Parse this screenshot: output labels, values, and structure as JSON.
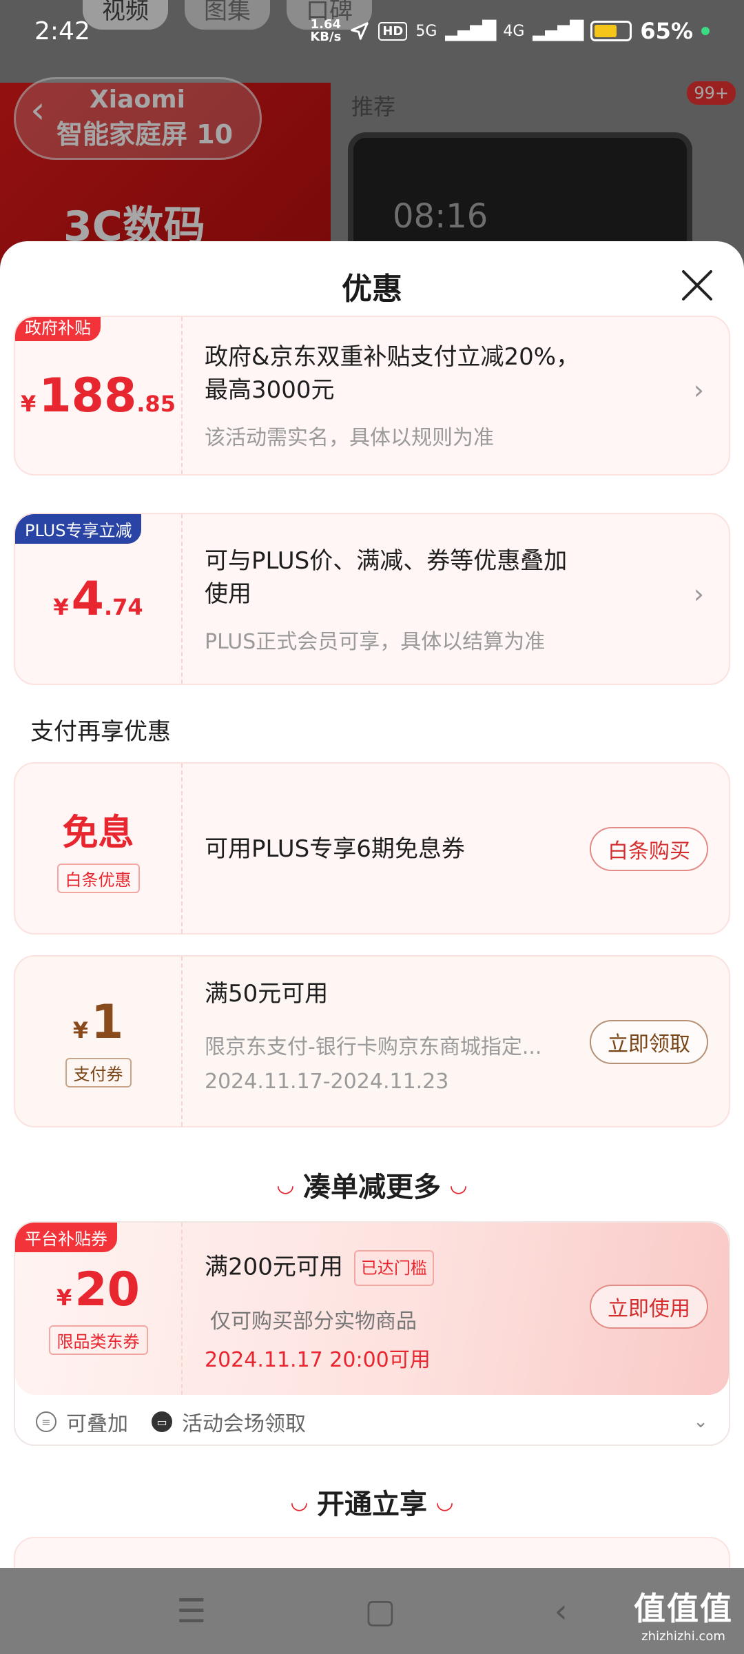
{
  "status_bar": {
    "time": "2:42",
    "speed_value": "1.64",
    "speed_unit": "KB/s",
    "hd": "HD",
    "net1": "5G",
    "net2": "4G",
    "battery": "65%",
    "battery_level": 0.65
  },
  "background": {
    "tabs": [
      "视频",
      "图集",
      "口碑"
    ],
    "banner_line1": "Xiaomi",
    "banner_line2": "智能家庭屏 10",
    "banner_category": "3C数码",
    "recommend": "推荐",
    "badge": "99+",
    "device_time": "08:16"
  },
  "sheet": {
    "title": "优惠",
    "offers": [
      {
        "tag": "政府补贴",
        "price_symbol": "¥",
        "price_int": "188",
        "price_dec": ".85",
        "title_line1": "政府&京东双重补贴支付立减20%，",
        "title_line2": "最高3000元",
        "subtitle": "该活动需实名，具体以规则为准"
      },
      {
        "tag": "PLUS专享立减",
        "price_symbol": "¥",
        "price_int": "4",
        "price_dec": ".74",
        "title_line1": "可与PLUS价、满减、券等优惠叠加",
        "title_line2": "使用",
        "subtitle": "PLUS正式会员可享，具体以结算为准"
      }
    ],
    "pay_section_label": "支付再享优惠",
    "baitiao": {
      "headline": "免息",
      "badge": "白条优惠",
      "text": "可用PLUS专享6期免息券",
      "button": "白条购买"
    },
    "pay_coupon": {
      "price_symbol": "¥",
      "price_int": "1",
      "badge": "支付券",
      "title": "满50元可用",
      "desc": "限京东支付-银行卡购京东商城指定...",
      "dates": "2024.11.17-2024.11.23",
      "button": "立即领取"
    },
    "more_heading": "凑单减更多",
    "platform_coupon": {
      "tag": "平台补贴券",
      "price_symbol": "¥",
      "price_int": "20",
      "badge": "限品类东券",
      "title": "满200元可用",
      "reached": "已达门槛",
      "desc": "仅可购买部分实物商品",
      "time": "2024.11.17 20:00可用",
      "button": "立即使用",
      "footer_stack": "可叠加",
      "footer_source": "活动会场领取"
    },
    "open_heading": "开通立享"
  },
  "watermark": {
    "big": "值值值",
    "small": "zhizhizhi.com"
  }
}
